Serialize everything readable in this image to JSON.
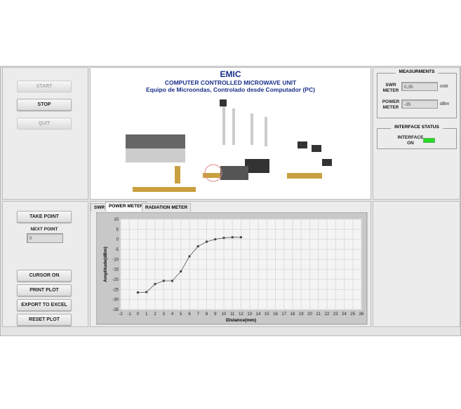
{
  "controls": {
    "start": "START",
    "stop": "STOP",
    "quit": "QUIT"
  },
  "header": {
    "title": "EMIC",
    "subtitle": "COMPUTER CONTROLLED MICROWAVE UNIT",
    "subtitle_es": "Equipo de Microondas, Controlado desde Computador (PC)"
  },
  "measurements": {
    "title": "MEASURMENTS",
    "swr_label": "SWR METER",
    "swr_value": "0,35",
    "swr_unit": "mW",
    "power_label": "POWER METER",
    "power_value": "-35",
    "power_unit": "dBm"
  },
  "interface": {
    "title": "INTERFACE STATUS",
    "label": "INTERFACE ON",
    "led_color": "#22dd22"
  },
  "actions": {
    "take_point": "TAKE POINT",
    "next_point_label": "NEXT POINT",
    "next_point_value": "0",
    "cursor_on": "CURSOR ON",
    "print_plot": "PRINT PLOT",
    "export": "EXPORT TO EXCEL",
    "reset": "RESET PLOT"
  },
  "tabs": [
    "SWR",
    "POWER METER",
    "RADIATION METER"
  ],
  "chart_data": {
    "type": "line",
    "xlabel": "Distance(mm)",
    "ylabel": "Amplitude(dBm)",
    "xlim": [
      -2,
      26
    ],
    "ylim": [
      -35,
      10
    ],
    "grid": true,
    "x": [
      0,
      1,
      2,
      3,
      4,
      5,
      6,
      7,
      8,
      9,
      10,
      11,
      12
    ],
    "y": [
      -26.5,
      -26.3,
      -22.3,
      -20.7,
      -20.7,
      -16,
      -8.5,
      -3.5,
      -1.2,
      0,
      0.7,
      1,
      1
    ],
    "xticks": [
      "-2",
      "-1",
      "0",
      "1",
      "2",
      "3",
      "4",
      "5",
      "6",
      "7",
      "8",
      "9",
      "10",
      "11",
      "12",
      "13",
      "14",
      "15",
      "16",
      "17",
      "18",
      "19",
      "20",
      "21",
      "22",
      "23",
      "24",
      "25",
      "26"
    ],
    "yticks": [
      "10",
      "5",
      "0",
      "-5",
      "-10",
      "-15",
      "-20",
      "-25",
      "-30",
      "-35"
    ]
  }
}
